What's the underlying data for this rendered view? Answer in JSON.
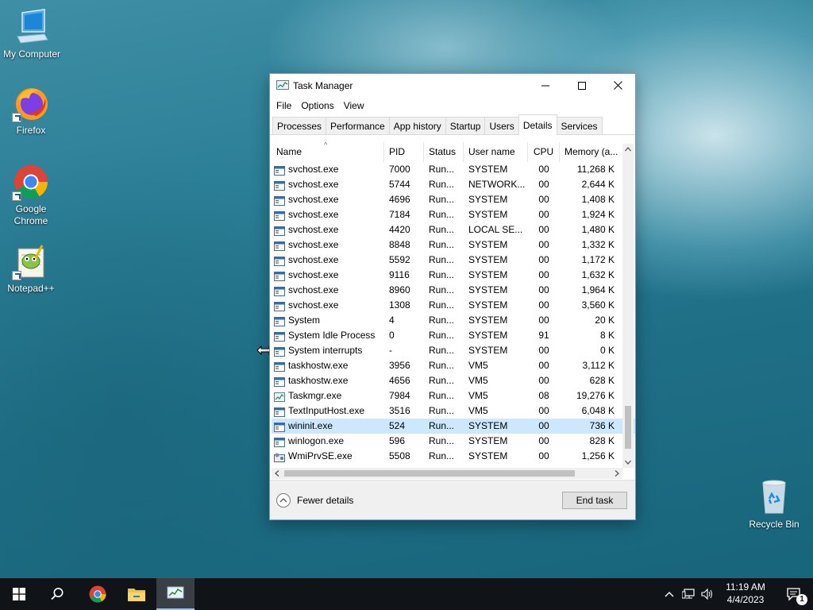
{
  "desktop": {
    "icons": [
      {
        "label": "My Computer"
      },
      {
        "label": "Firefox"
      },
      {
        "label": "Google Chrome"
      },
      {
        "label": "Notepad++"
      },
      {
        "label": "Recycle Bin"
      }
    ]
  },
  "window": {
    "title": "Task Manager",
    "menu": [
      "File",
      "Options",
      "View"
    ],
    "tabs": [
      "Processes",
      "Performance",
      "App history",
      "Startup",
      "Users",
      "Details",
      "Services"
    ],
    "active_tab": "Details",
    "columns": [
      "Name",
      "PID",
      "Status",
      "User name",
      "CPU",
      "Memory (a..."
    ],
    "rows": [
      {
        "name": "svchost.exe",
        "pid": "7000",
        "status": "Run...",
        "user": "SYSTEM",
        "cpu": "00",
        "mem": "11,268 K"
      },
      {
        "name": "svchost.exe",
        "pid": "5744",
        "status": "Run...",
        "user": "NETWORK...",
        "cpu": "00",
        "mem": "2,644 K"
      },
      {
        "name": "svchost.exe",
        "pid": "4696",
        "status": "Run...",
        "user": "SYSTEM",
        "cpu": "00",
        "mem": "1,408 K"
      },
      {
        "name": "svchost.exe",
        "pid": "7184",
        "status": "Run...",
        "user": "SYSTEM",
        "cpu": "00",
        "mem": "1,924 K"
      },
      {
        "name": "svchost.exe",
        "pid": "4420",
        "status": "Run...",
        "user": "LOCAL SE...",
        "cpu": "00",
        "mem": "1,480 K"
      },
      {
        "name": "svchost.exe",
        "pid": "8848",
        "status": "Run...",
        "user": "SYSTEM",
        "cpu": "00",
        "mem": "1,332 K"
      },
      {
        "name": "svchost.exe",
        "pid": "5592",
        "status": "Run...",
        "user": "SYSTEM",
        "cpu": "00",
        "mem": "1,172 K"
      },
      {
        "name": "svchost.exe",
        "pid": "9116",
        "status": "Run...",
        "user": "SYSTEM",
        "cpu": "00",
        "mem": "1,632 K"
      },
      {
        "name": "svchost.exe",
        "pid": "8960",
        "status": "Run...",
        "user": "SYSTEM",
        "cpu": "00",
        "mem": "1,964 K"
      },
      {
        "name": "svchost.exe",
        "pid": "1308",
        "status": "Run...",
        "user": "SYSTEM",
        "cpu": "00",
        "mem": "3,560 K"
      },
      {
        "name": "System",
        "pid": "4",
        "status": "Run...",
        "user": "SYSTEM",
        "cpu": "00",
        "mem": "20 K"
      },
      {
        "name": "System Idle Process",
        "pid": "0",
        "status": "Run...",
        "user": "SYSTEM",
        "cpu": "91",
        "mem": "8 K"
      },
      {
        "name": "System interrupts",
        "pid": "-",
        "status": "Run...",
        "user": "SYSTEM",
        "cpu": "00",
        "mem": "0 K"
      },
      {
        "name": "taskhostw.exe",
        "pid": "3956",
        "status": "Run...",
        "user": "VM5",
        "cpu": "00",
        "mem": "3,112 K"
      },
      {
        "name": "taskhostw.exe",
        "pid": "4656",
        "status": "Run...",
        "user": "VM5",
        "cpu": "00",
        "mem": "628 K"
      },
      {
        "name": "Taskmgr.exe",
        "pid": "7984",
        "status": "Run...",
        "user": "VM5",
        "cpu": "08",
        "mem": "19,276 K"
      },
      {
        "name": "TextInputHost.exe",
        "pid": "3516",
        "status": "Run...",
        "user": "VM5",
        "cpu": "00",
        "mem": "6,048 K"
      },
      {
        "name": "wininit.exe",
        "pid": "524",
        "status": "Run...",
        "user": "SYSTEM",
        "cpu": "00",
        "mem": "736 K"
      },
      {
        "name": "winlogon.exe",
        "pid": "596",
        "status": "Run...",
        "user": "SYSTEM",
        "cpu": "00",
        "mem": "828 K"
      },
      {
        "name": "WmiPrvSE.exe",
        "pid": "5508",
        "status": "Run...",
        "user": "SYSTEM",
        "cpu": "00",
        "mem": "1,256 K"
      }
    ],
    "selected_row": 17,
    "footer": {
      "fewer_details": "Fewer details",
      "end_task": "End task"
    }
  },
  "taskbar": {
    "time": "11:19 AM",
    "date": "4/4/2023",
    "notification_count": "1"
  }
}
